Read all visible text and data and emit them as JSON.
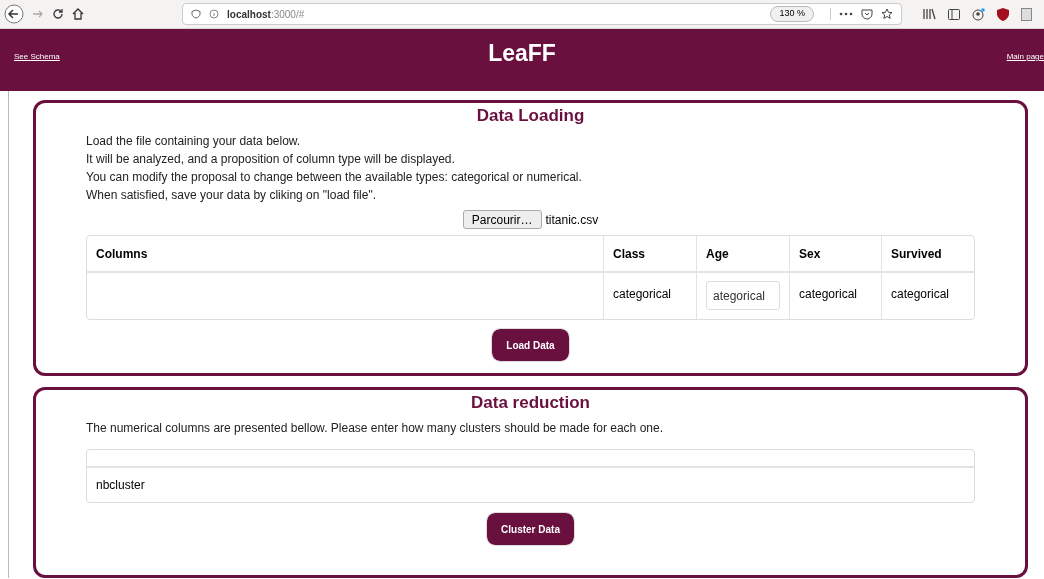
{
  "browser": {
    "url_host": "localhost",
    "url_rest": ":3000/#",
    "zoom": "130 %"
  },
  "header": {
    "left_link": "See Schema",
    "title": "LeaFF",
    "right_link": "Main page"
  },
  "data_loading": {
    "title": "Data Loading",
    "instructions": [
      "Load the file containing your data below.",
      "It will be analyzed, and a proposition of column type will be displayed.",
      "You can modify the proposal to change between the available types: categorical or numerical.",
      "When satisfied, save your data by cliking on \"load file\"."
    ],
    "file_button": "Parcourir…",
    "file_name": "titanic.csv",
    "table": {
      "columns": [
        "Columns",
        "Class",
        "Age",
        "Sex",
        "Survived"
      ],
      "row": [
        {
          "kind": "empty"
        },
        {
          "kind": "text",
          "value": "categorical"
        },
        {
          "kind": "input",
          "value": "ategorical"
        },
        {
          "kind": "text",
          "value": "categorical"
        },
        {
          "kind": "text",
          "value": "categorical"
        }
      ]
    },
    "button": "Load Data"
  },
  "data_reduction": {
    "title": "Data reduction",
    "description": "The numerical columns are presented bellow. Please enter how many clusters should be made for each one.",
    "row_label": "nbcluster",
    "button": "Cluster Data"
  }
}
